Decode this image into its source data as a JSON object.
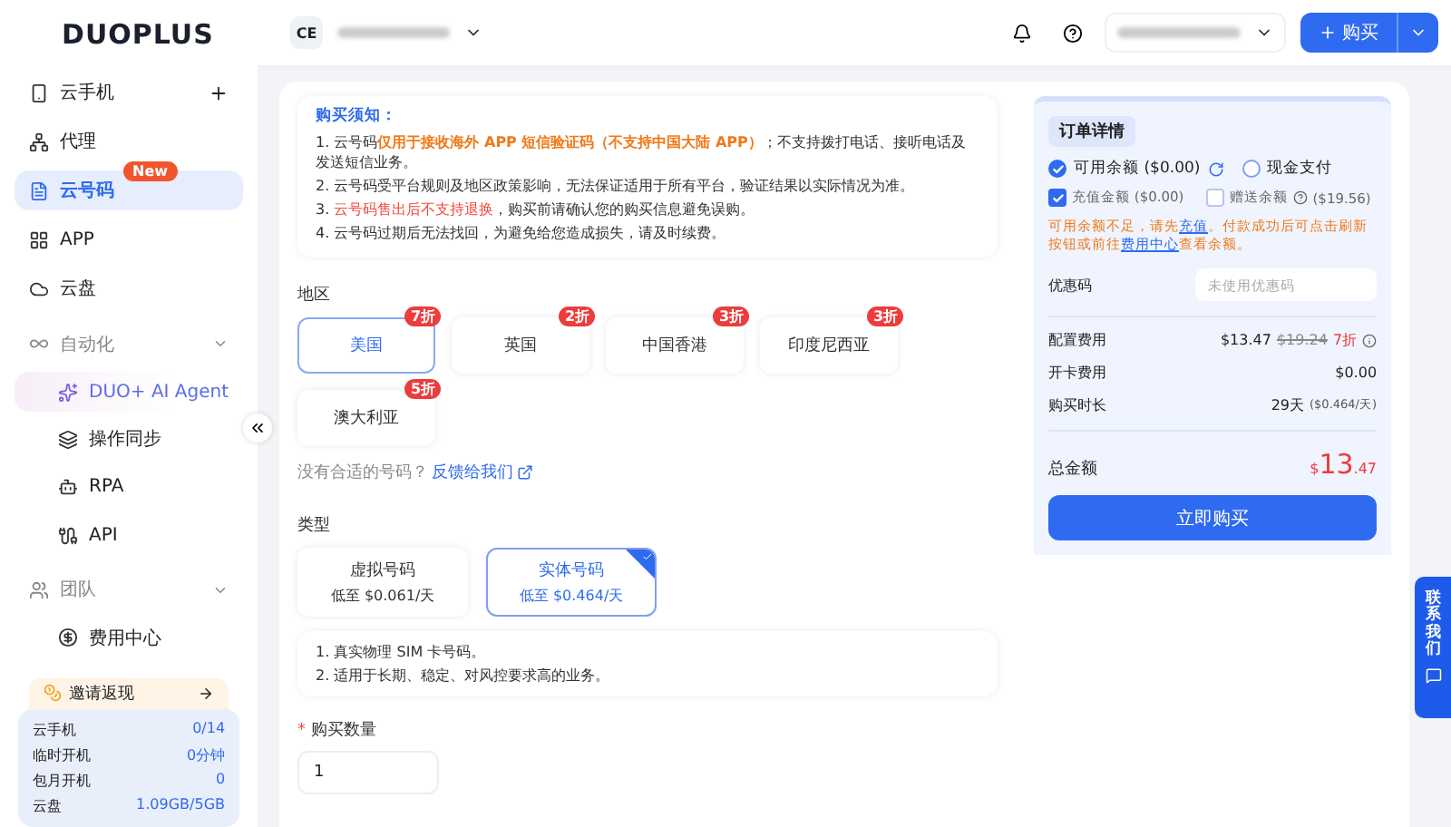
{
  "logo": {
    "text": "DUOPLUS"
  },
  "sidebar": {
    "items": [
      {
        "kind": "item",
        "label": "云手机",
        "selected": false,
        "has_add": true
      },
      {
        "kind": "item",
        "label": "代理",
        "selected": false
      },
      {
        "kind": "item",
        "label": "云号码",
        "selected": true,
        "badge": "New"
      },
      {
        "kind": "item",
        "label": "APP",
        "selected": false
      },
      {
        "kind": "item",
        "label": "云盘",
        "selected": false
      },
      {
        "kind": "group",
        "label": "自动化",
        "expanded": true,
        "children": [
          {
            "label": "DUO+ AI Agent",
            "special": true
          },
          {
            "label": "操作同步",
            "special": false
          },
          {
            "label": "RPA",
            "special": false
          },
          {
            "label": "API",
            "special": false
          }
        ]
      },
      {
        "kind": "group",
        "label": "团队",
        "expanded": true,
        "children": [
          {
            "label": "费用中心",
            "special": false
          }
        ]
      }
    ],
    "invite": {
      "label": "邀请返现"
    },
    "stats": [
      {
        "label": "云手机",
        "value": "0/14"
      },
      {
        "label": "临时开机",
        "value": "0分钟"
      },
      {
        "label": "包月开机",
        "value": "0"
      },
      {
        "label": "云盘",
        "value": "1.09GB/5GB"
      }
    ]
  },
  "topbar": {
    "avatar": "CE",
    "buy_button": "购买"
  },
  "notice": {
    "title": "购买须知：",
    "lines": [
      [
        {
          "kind": "normal",
          "text": "1. 云号码"
        },
        {
          "kind": "highlight",
          "text": "仅用于接收海外 APP 短信验证码（不支持中国大陆 APP）"
        },
        {
          "kind": "normal",
          "text": "；不支持拨打电话、接听电话及发送短信业务。"
        }
      ],
      [
        {
          "kind": "normal",
          "text": "2. 云号码受平台规则及地区政策影响，无法保证适用于所有平台，验证结果以实际情况为准。"
        }
      ],
      [
        {
          "kind": "normal",
          "text": "3. "
        },
        {
          "kind": "warning",
          "text": "云号码售出后不支持退换"
        },
        {
          "kind": "normal",
          "text": "，购买前请确认您的购买信息避免误购。"
        }
      ],
      [
        {
          "kind": "normal",
          "text": "4. 云号码过期后无法找回，为避免给您造成损失，请及时续费。"
        }
      ]
    ]
  },
  "region": {
    "label": "地区",
    "options": [
      {
        "label": "美国",
        "discount": "7折",
        "selected": true
      },
      {
        "label": "英国",
        "discount": "2折",
        "selected": false
      },
      {
        "label": "中国香港",
        "discount": "3折",
        "selected": false
      },
      {
        "label": "印度尼西亚",
        "discount": "3折",
        "selected": false
      },
      {
        "label": "澳大利亚",
        "discount": "5折",
        "selected": false
      }
    ],
    "feedback_text": "没有合适的号码？",
    "feedback_link": "反馈给我们"
  },
  "type": {
    "label": "类型",
    "options": [
      {
        "name": "虚拟号码",
        "price": "低至 $0.061/天",
        "selected": false
      },
      {
        "name": "实体号码",
        "price": "低至 $0.464/天",
        "selected": true
      }
    ],
    "notes": [
      "1. 真实物理 SIM 卡号码。",
      "2. 适用于长期、稳定、对风控要求高的业务。"
    ]
  },
  "quantity": {
    "label": "购买数量",
    "required_mark": "*",
    "value": "1"
  },
  "order": {
    "title": "订单详情",
    "payments": [
      {
        "label": "可用余额 ($0.00)",
        "selected": true,
        "refresh": true
      },
      {
        "label": "现金支付",
        "selected": false
      }
    ],
    "balances": [
      {
        "label": "充值金额 ($0.00)",
        "checked": true
      },
      {
        "label": "赠送余额",
        "amount": "($19.56)",
        "checked": false,
        "help": true
      }
    ],
    "warning": [
      {
        "kind": "text",
        "text": "可用余额不足，请先"
      },
      {
        "kind": "link",
        "text": "充值"
      },
      {
        "kind": "text",
        "text": "。付款成功后可点击刷新按钮或前往"
      },
      {
        "kind": "link",
        "text": "费用中心"
      },
      {
        "kind": "text",
        "text": "查看余额。"
      }
    ],
    "coupon": {
      "label": "优惠码",
      "placeholder": "未使用优惠码"
    },
    "fees": [
      {
        "label": "配置费用",
        "value": "$13.47",
        "original": "$19.24",
        "discount": "7折"
      },
      {
        "label": "开卡费用",
        "value": "$0.00"
      },
      {
        "label": "购买时长",
        "value": "29天",
        "unit": "($0.464/天)"
      }
    ],
    "total": {
      "label": "总金额",
      "currency": "$",
      "integer": "13",
      "decimal": ".47"
    },
    "buy_now": "立即购买"
  },
  "contact": {
    "label": "联系我们"
  }
}
